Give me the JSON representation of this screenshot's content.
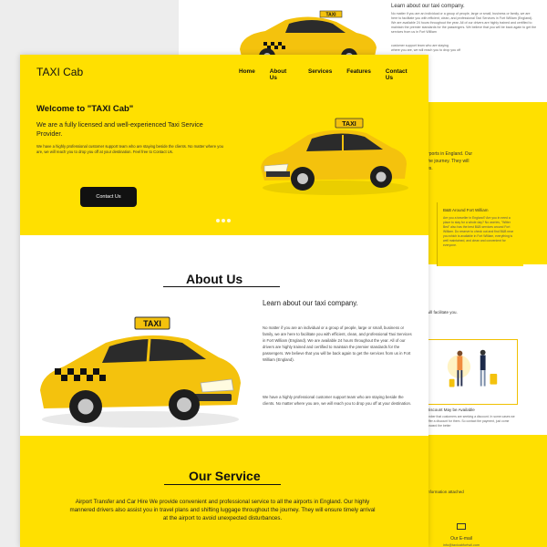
{
  "background_page": {
    "learn_title": "Learn about our taxi company.",
    "learn_body": "No matter if you are an individual or a group of people, large or small, business or family, we are here to facilitate you with efficient, clean, and professional Taxi Services in Fort William (England). We are available 24 hours throughout the year. All of our drivers are highly trained and certified to maintain the premier standards for the passengers. We believe that you will be back again to get the services from us in Fort William",
    "lines_top": "customer support team who are staying\nwhere you are, we will reach you to drop you off",
    "airports": "irports in England. Our\nthe journey. They will\nes.",
    "card_title": "B&B Around Fort William",
    "card_body": "Are you a traveller in England? Are you in need a place to stay for a whole day? No worries, \"Witter Bed\" also has the best B&B services around Fort William. Do reserve to check out and find B&B near you which is available in Fort William, everything is well maintained, and clean and convenient for everyone.",
    "facilitate": "will facilitate you.",
    "discount_title": "Discount May be Available",
    "discount_body": "ember that customers are seeking a discount. In some cases we offer a discount for them. So contact the payment, just come forward the better",
    "information": "information attached",
    "email_label": "Our E-mail",
    "email_value": "info@taxicabfortwil.com"
  },
  "header": {
    "logo": "TAXI Cab",
    "nav": [
      "Home",
      "About Us",
      "Services",
      "Features",
      "Contact Us"
    ]
  },
  "hero": {
    "title": "Welcome to \"TAXI Cab\"",
    "subtitle": "We are a fully licensed and well-experienced Taxi Service Provider.",
    "body": "We have a highly professional customer support team who are staying beside the clients. No matter where you are, we will reach you to drop you off at your destination. Feel free to Contact Us.",
    "button": "Contact Us"
  },
  "about": {
    "heading": "About Us",
    "learn_title": "Learn about our taxi company.",
    "para1": "No matter if you are an individual or a group of people, large or small, business or family, we are here to facilitate you with efficient, clean, and professional Taxi Services in Fort William (England). We are available 24 hours throughout the year. All of our drivers are highly trained and certified to maintain the premier standards for the passengers. We believe that you will be back again to get the services from us in Fort William (England).",
    "para2": "We have a highly professional customer support team who are staying beside the clients. No matter where you are, we will reach you to drop you off at your destination."
  },
  "service": {
    "heading": "Our Service",
    "text": "Airport Transfer and Car Hire We provide convenient and professional service to all the airports in England. Our highly mannered drivers also assist you in travel plans and shifting luggage throughout the journey. They will ensure timely arrival at the airport to avoid unexpected disturbances."
  },
  "taxi_sign": "TAXI",
  "colors": {
    "brand_yellow": "#ffe000",
    "dark": "#111111"
  }
}
